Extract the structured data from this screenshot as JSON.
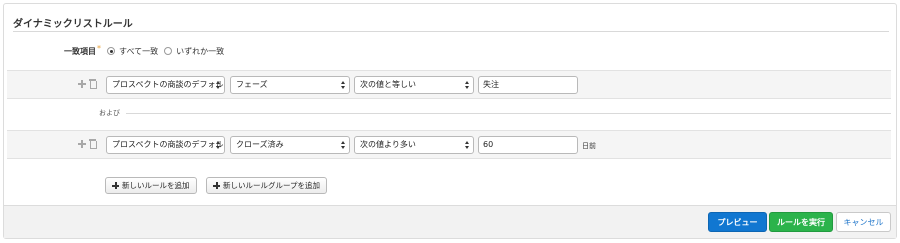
{
  "panel": {
    "title": "ダイナミックリストルール"
  },
  "match": {
    "label": "一致項目",
    "required_mark": "*",
    "options": [
      {
        "label": "すべて一致",
        "selected": true
      },
      {
        "label": "いずれか一致",
        "selected": false
      }
    ]
  },
  "rules": [
    {
      "field": "プロスペクトの商談のデフォルト",
      "attribute": "フェーズ",
      "operator": "次の値と等しい",
      "value": "失注",
      "unit": ""
    },
    {
      "field": "プロスペクトの商談のデフォルト",
      "attribute": "クローズ済み",
      "operator": "次の値より多い",
      "value": "60",
      "unit": "日前"
    }
  ],
  "connector": {
    "label": "および"
  },
  "actions": {
    "add_rule": "新しいルールを追加",
    "add_rule_group": "新しいルールグループを追加"
  },
  "footer": {
    "preview": "プレビュー",
    "run_rules": "ルールを実行",
    "cancel": "キャンセル"
  },
  "colors": {
    "primary": "#1177d1",
    "success": "#2bb34b",
    "required": "#e8a33d"
  }
}
